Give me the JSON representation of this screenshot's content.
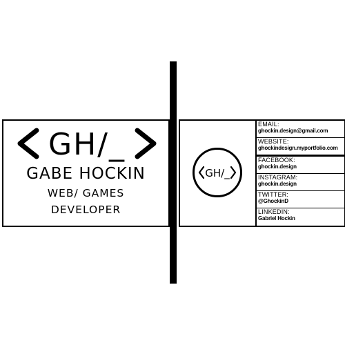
{
  "front": {
    "logo_text": "<GH/_>",
    "name": "GABE HOCKIN",
    "role_line_1": "WEB/ GAMES",
    "role_line_2": "DEVELOPER"
  },
  "back": {
    "logo_text": "<GH/_>",
    "contacts": [
      {
        "label": "EMAIL:",
        "value": "ghockin.design@gmail.com"
      },
      {
        "label": "WEBSITE:",
        "value": "ghockindesign.myportfolio.com"
      },
      {
        "label": "FACEBOOK:",
        "value": "ghockin.design"
      },
      {
        "label": "INSTAGRAM:",
        "value": "ghockin.design"
      },
      {
        "label": "TWITTER:",
        "value": "@GhockinD"
      },
      {
        "label": "LINKEDIN:",
        "value": "Gabriel Hockin"
      }
    ]
  },
  "colors": {
    "ink": "#000000",
    "background": "#ffffff"
  }
}
